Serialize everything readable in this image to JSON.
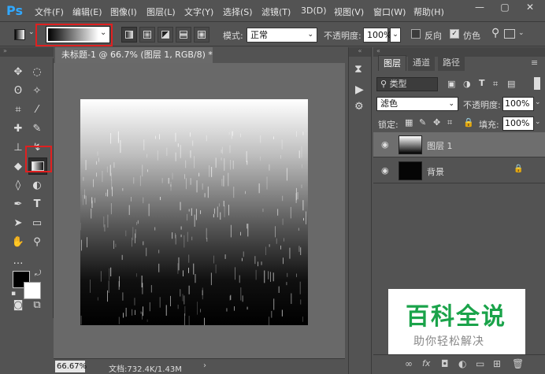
{
  "app": {
    "logo": "Ps"
  },
  "menu": [
    "文件(F)",
    "编辑(E)",
    "图像(I)",
    "图层(L)",
    "文字(Y)",
    "选择(S)",
    "滤镜(T)",
    "3D(D)",
    "视图(V)",
    "窗口(W)",
    "帮助(H)"
  ],
  "window_controls": {
    "minimize": "—",
    "maximize": "▢",
    "close": "✕"
  },
  "options": {
    "mode_label": "模式:",
    "mode_value": "正常",
    "opacity_label": "不透明度:",
    "opacity_value": "100%",
    "reverse_label": "反向",
    "dither_label": "仿色"
  },
  "document": {
    "tab_title": "未标题-1 @ 66.7% (图层 1, RGB/8) *",
    "zoom": "66.67%",
    "doc_info": "文档:732.4K/1.43M"
  },
  "layers_panel": {
    "tabs": [
      "图层",
      "通道",
      "路径"
    ],
    "filter_kind": "类型",
    "blend_mode": "滤色",
    "opacity_label": "不透明度:",
    "opacity_value": "100%",
    "lock_label": "锁定:",
    "fill_label": "填充:",
    "fill_value": "100%",
    "layers": [
      {
        "name": "图层 1"
      },
      {
        "name": "背景"
      }
    ]
  },
  "watermark": {
    "title": "百科全说",
    "subtitle": "助你轻松解决"
  },
  "colors": {
    "accent": "#31a8ff",
    "highlight_box": "#e02020",
    "watermark_green": "#1aa34a"
  }
}
